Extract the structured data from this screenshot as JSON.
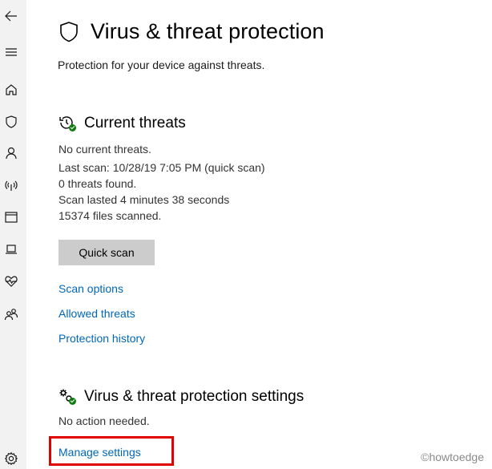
{
  "sidebar": {
    "items": [
      {
        "name": "back",
        "icon": "back-arrow-icon"
      },
      {
        "name": "menu",
        "icon": "hamburger-menu-icon"
      },
      {
        "name": "home",
        "icon": "home-icon"
      },
      {
        "name": "virus-protection",
        "icon": "shield-icon"
      },
      {
        "name": "account-protection",
        "icon": "person-icon"
      },
      {
        "name": "firewall-network",
        "icon": "wireless-signal-icon"
      },
      {
        "name": "app-browser-control",
        "icon": "browser-window-icon"
      },
      {
        "name": "device-security",
        "icon": "laptop-icon"
      },
      {
        "name": "device-performance",
        "icon": "heart-pulse-icon"
      },
      {
        "name": "family-options",
        "icon": "family-icon"
      },
      {
        "name": "settings",
        "icon": "gear-icon"
      }
    ]
  },
  "header": {
    "title": "Virus & threat protection",
    "subtitle": "Protection for your device against threats."
  },
  "current_threats": {
    "heading": "Current threats",
    "status": "No current threats.",
    "last_scan": "Last scan: 10/28/19 7:05 PM (quick scan)",
    "threats_found": "0 threats found.",
    "duration": "Scan lasted 4 minutes 38 seconds",
    "files_scanned": "15374 files scanned.",
    "quick_scan_label": "Quick scan",
    "links": {
      "scan_options": "Scan options",
      "allowed_threats": "Allowed threats",
      "protection_history": "Protection history"
    }
  },
  "protection_settings": {
    "heading": "Virus & threat protection settings",
    "status": "No action needed.",
    "manage_link": "Manage settings"
  },
  "watermark": "©howtoedge",
  "colors": {
    "link": "#0067b8",
    "status_ok": "#107c10",
    "highlight": "#e00000",
    "sidebar_bg": "#f2f2f2"
  }
}
